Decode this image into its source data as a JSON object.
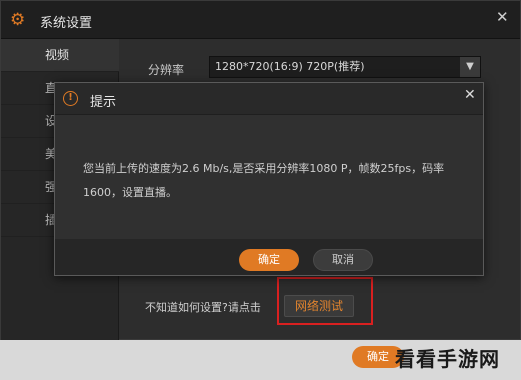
{
  "window": {
    "title": "系统设置",
    "close_glyph": "✕",
    "title_icon": "gear-icon",
    "title_icon_glyph": "⚙"
  },
  "sidebar": {
    "items": [
      {
        "label": "视频",
        "active": true
      },
      {
        "label": "直"
      },
      {
        "label": "设"
      },
      {
        "label": "美"
      },
      {
        "label": "强"
      },
      {
        "label": "插"
      }
    ]
  },
  "video": {
    "resolution_label": "分辨率",
    "resolution_value": "1280*720(16:9) 720P(推荐)",
    "dropdown_arrow": "▼"
  },
  "help": {
    "text": "不知道如何设置?请点击",
    "network_test_label": "网络测试"
  },
  "dialog": {
    "title": "提示",
    "icon": "info-icon",
    "icon_glyph": "!",
    "close_glyph": "✕",
    "message": "您当前上传的速度为2.6 Mb/s,是否采用分辨率1080 P，帧数25fps，码率1600，设置直播。",
    "ok_label": "确定",
    "cancel_label": "取消"
  },
  "footer": {
    "ok_label": "确定"
  },
  "watermark": "看看手游网",
  "colors": {
    "accent": "#e07a24",
    "highlight_box": "#d92020",
    "background": "#2d2d2d"
  }
}
